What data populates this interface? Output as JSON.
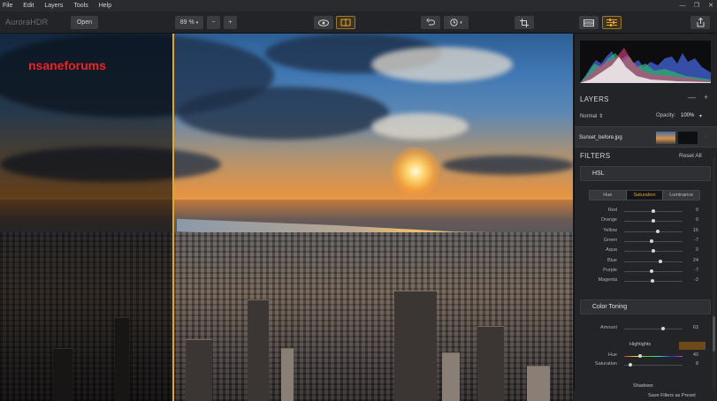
{
  "menu": [
    "File",
    "Edit",
    "Layers",
    "Tools",
    "Help"
  ],
  "toolbar": {
    "app_name": "AuroraHDR",
    "open_label": "Open",
    "zoom_label": "89 %",
    "zoom_minus": "−",
    "zoom_plus": "+"
  },
  "canvas": {
    "watermark": "nsaneforums"
  },
  "layers": {
    "title": "LAYERS",
    "blend_mode": "Normal",
    "opacity_label": "Opacity:",
    "opacity_value": "100%",
    "layer_name": "Sunset_before.jpg"
  },
  "filters": {
    "title": "FILTERS",
    "reset_all": "Reset All",
    "hsl_title": "HSL",
    "tabs": [
      "Hue",
      "Saturation",
      "Luminance"
    ],
    "active_tab": "Saturation",
    "hsl_rows": [
      {
        "label": "Red",
        "value": 0
      },
      {
        "label": "Orange",
        "value": 0
      },
      {
        "label": "Yellow",
        "value": 16
      },
      {
        "label": "Green",
        "value": -7
      },
      {
        "label": "Aqua",
        "value": 0
      },
      {
        "label": "Blue",
        "value": 24
      },
      {
        "label": "Purple",
        "value": -7
      },
      {
        "label": "Magenta",
        "value": -2
      }
    ],
    "color_toning_title": "Color Toning",
    "amount_label": "Amount",
    "amount_value": "63",
    "highlights_label": "Highlights",
    "hue_label": "Hue",
    "hue_value": "40",
    "saturation_label": "Saturation",
    "saturation_value": "8",
    "shadows_label": "Shadows",
    "save_preset": "Save Filters as Preset"
  },
  "colors": {
    "accent": "#e3a52a",
    "panel_bg": "#232427",
    "watermark": "#e22222"
  }
}
